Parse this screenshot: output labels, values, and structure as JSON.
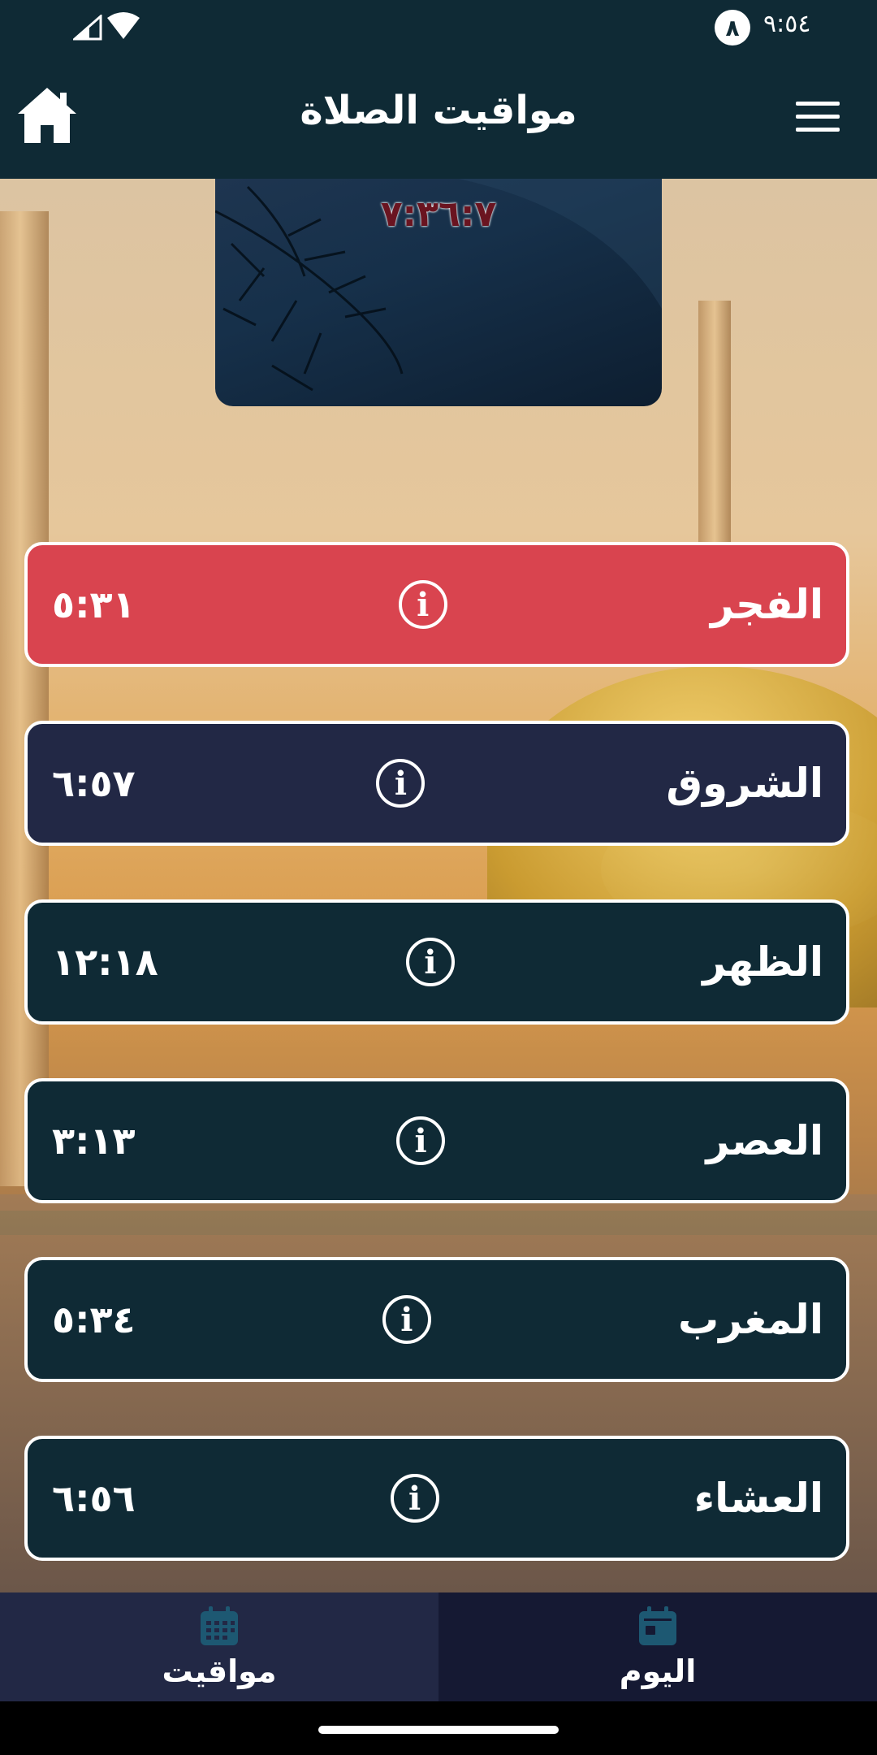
{
  "status_bar": {
    "time": "٩:٥٤",
    "notification_badge": "٨"
  },
  "header": {
    "title": "مواقيت الصلاة"
  },
  "countdown": {
    "remaining": "٧:٣٦:٧"
  },
  "prayers": [
    {
      "name": "الفجر",
      "time": "٥:٣١",
      "active": true
    },
    {
      "name": "الشروق",
      "time": "٦:٥٧",
      "active": false
    },
    {
      "name": "الظهر",
      "time": "١٢:١٨",
      "active": false
    },
    {
      "name": "العصر",
      "time": "٣:١٣",
      "active": false
    },
    {
      "name": "المغرب",
      "time": "٥:٣٤",
      "active": false
    },
    {
      "name": "العشاء",
      "time": "٦:٥٦",
      "active": false
    }
  ],
  "bottom_nav": [
    {
      "label": "مواقيت",
      "icon": "calendar-grid-icon",
      "selected": false
    },
    {
      "label": "اليوم",
      "icon": "calendar-today-icon",
      "selected": true
    }
  ],
  "colors": {
    "header_bg": "#0f2a35",
    "active_card": "#d9444f",
    "sunrise_card": "#222845",
    "card": "#0f2a35",
    "nav_left": "#222845",
    "nav_right": "#151933",
    "nav_icon": "#1d5872"
  }
}
